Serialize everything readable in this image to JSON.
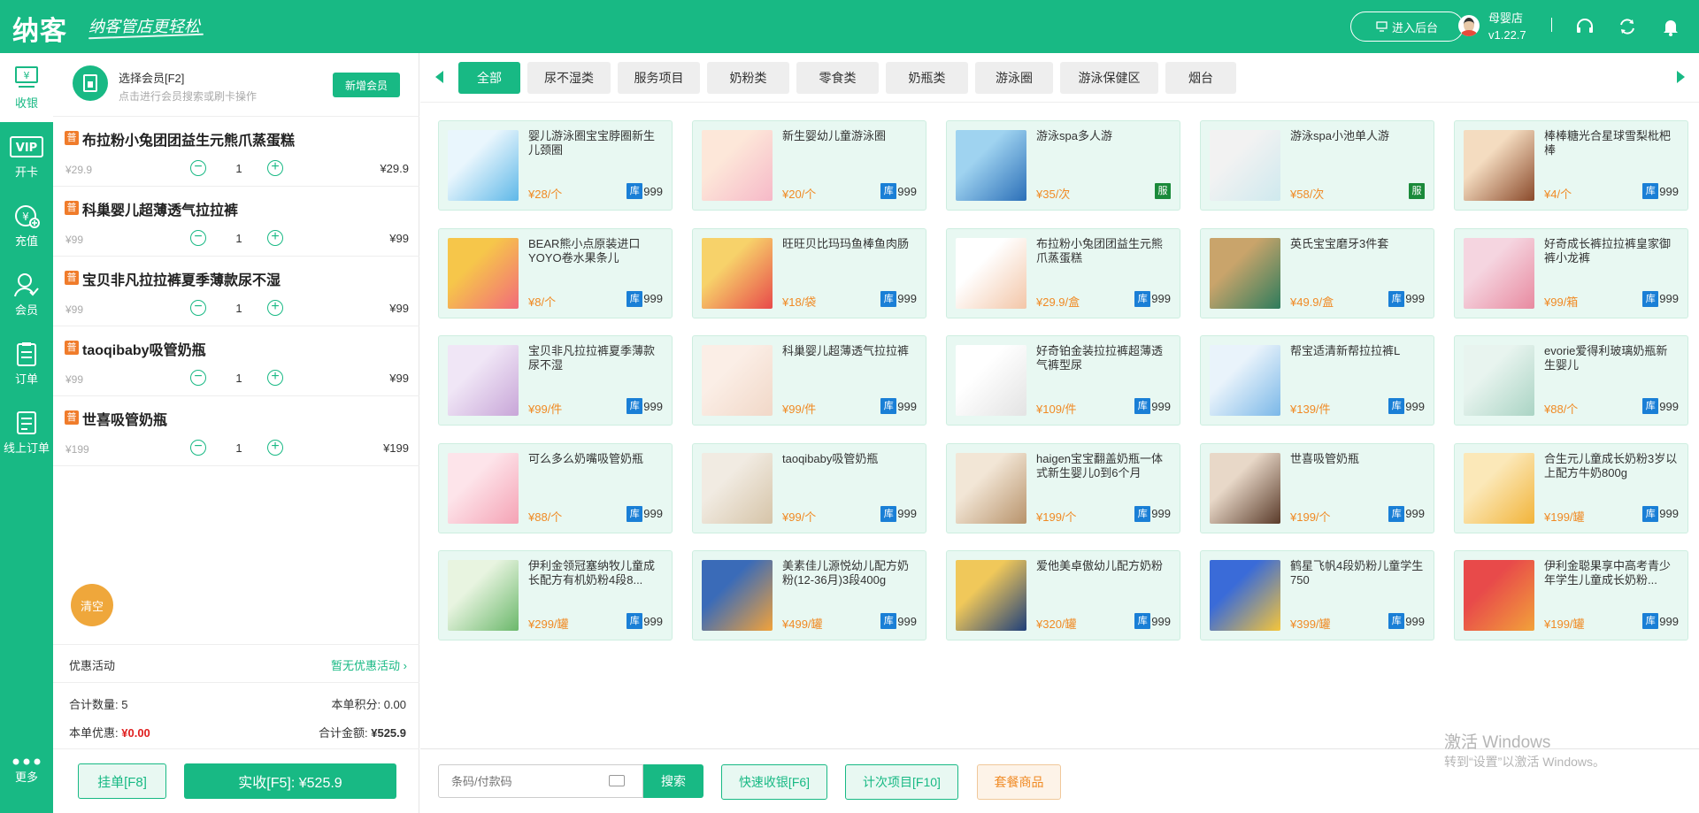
{
  "header": {
    "logo": "纳客",
    "slogan": "纳客管店更轻松",
    "backend_button": "进入后台",
    "store_name": "母婴店",
    "version": "v1.22.7"
  },
  "sidebar": {
    "items": [
      {
        "label": "收银",
        "icon": "cashier-icon"
      },
      {
        "label": "开卡",
        "icon": "vip-card-icon"
      },
      {
        "label": "充值",
        "icon": "recharge-icon"
      },
      {
        "label": "会员",
        "icon": "member-icon"
      },
      {
        "label": "订单",
        "icon": "order-icon"
      },
      {
        "label": "线上订单",
        "icon": "online-order-icon"
      }
    ],
    "more": "更多"
  },
  "member": {
    "title": "选择会员[F2]",
    "subtitle": "点击进行会员搜索或刷卡操作",
    "add_button": "新增会员"
  },
  "cart": {
    "badge": "普",
    "items": [
      {
        "name": "布拉粉小兔团团益生元熊爪蒸蛋糕",
        "price": "¥29.9",
        "qty": "1",
        "total": "¥29.9"
      },
      {
        "name": "科巢婴儿超薄透气拉拉裤",
        "price": "¥99",
        "qty": "1",
        "total": "¥99"
      },
      {
        "name": "宝贝非凡拉拉裤夏季薄款尿不湿",
        "price": "¥99",
        "qty": "1",
        "total": "¥99"
      },
      {
        "name": "taoqibaby吸管奶瓶",
        "price": "¥99",
        "qty": "1",
        "total": "¥99"
      },
      {
        "name": "世喜吸管奶瓶",
        "price": "¥199",
        "qty": "1",
        "total": "¥199"
      }
    ],
    "clear": "清空",
    "promo_label": "优惠活动",
    "promo_value": "暂无优惠活动",
    "total_qty_label": "合计数量:",
    "total_qty": "5",
    "points_label": "本单积分:",
    "points": "0.00",
    "discount_label": "本单优惠:",
    "discount": "¥0.00",
    "amount_label": "合计金额:",
    "amount": "¥525.9",
    "hang_button": "挂单[F8]",
    "pay_button": "实收[F5]: ¥525.9"
  },
  "tabs": [
    "全部",
    "尿不湿类",
    "服务项目",
    "奶粉类",
    "零食类",
    "奶瓶类",
    "游泳圈",
    "游泳保健区",
    "烟台"
  ],
  "stock_tag": "库",
  "service_tag": "服",
  "products": [
    {
      "name": "婴儿游泳圈宝宝脖圈新生儿颈圈",
      "price": "¥28/个",
      "stock": "999",
      "svc": false
    },
    {
      "name": "新生婴幼儿童游泳圈",
      "price": "¥20/个",
      "stock": "999",
      "svc": false
    },
    {
      "name": "游泳spa多人游",
      "price": "¥35/次",
      "stock": "",
      "svc": true
    },
    {
      "name": "游泳spa小池单人游",
      "price": "¥58/次",
      "stock": "",
      "svc": true
    },
    {
      "name": "棒棒糖光合星球雪梨枇杷棒",
      "price": "¥4/个",
      "stock": "999",
      "svc": false
    },
    {
      "name": "BEAR熊小点原装进口YOYO卷水果条儿",
      "price": "¥8/个",
      "stock": "999",
      "svc": false
    },
    {
      "name": "旺旺贝比玛玛鱼棒鱼肉肠",
      "price": "¥18/袋",
      "stock": "999",
      "svc": false
    },
    {
      "name": "布拉粉小兔团团益生元熊爪蒸蛋糕",
      "price": "¥29.9/盒",
      "stock": "999",
      "svc": false
    },
    {
      "name": "英氏宝宝磨牙3件套",
      "price": "¥49.9/盒",
      "stock": "999",
      "svc": false
    },
    {
      "name": "好奇成长裤拉拉裤皇家御裤小龙裤",
      "price": "¥99/箱",
      "stock": "999",
      "svc": false
    },
    {
      "name": "宝贝非凡拉拉裤夏季薄款尿不湿",
      "price": "¥99/件",
      "stock": "999",
      "svc": false
    },
    {
      "name": "科巢婴儿超薄透气拉拉裤",
      "price": "¥99/件",
      "stock": "999",
      "svc": false
    },
    {
      "name": "好奇铂金装拉拉裤超薄透气裤型尿",
      "price": "¥109/件",
      "stock": "999",
      "svc": false
    },
    {
      "name": "帮宝适清新帮拉拉裤L",
      "price": "¥139/件",
      "stock": "999",
      "svc": false
    },
    {
      "name": "evorie爱得利玻璃奶瓶新生婴儿",
      "price": "¥88/个",
      "stock": "999",
      "svc": false
    },
    {
      "name": "可么多么奶嘴吸管奶瓶",
      "price": "¥88/个",
      "stock": "999",
      "svc": false
    },
    {
      "name": "taoqibaby吸管奶瓶",
      "price": "¥99/个",
      "stock": "999",
      "svc": false
    },
    {
      "name": "haigen宝宝翻盖奶瓶一体式新生婴儿0到6个月",
      "price": "¥199/个",
      "stock": "999",
      "svc": false
    },
    {
      "name": "世喜吸管奶瓶",
      "price": "¥199/个",
      "stock": "999",
      "svc": false
    },
    {
      "name": "合生元儿童成长奶粉3岁以上配方牛奶800g",
      "price": "¥199/罐",
      "stock": "999",
      "svc": false
    },
    {
      "name": "伊利金领冠塞纳牧儿童成长配方有机奶粉4段8...",
      "price": "¥299/罐",
      "stock": "999",
      "svc": false
    },
    {
      "name": "美素佳儿源悦幼儿配方奶粉(12-36月)3段400g",
      "price": "¥499/罐",
      "stock": "999",
      "svc": false
    },
    {
      "name": "爱他美卓傲幼儿配方奶粉",
      "price": "¥320/罐",
      "stock": "999",
      "svc": false
    },
    {
      "name": "鹤星飞帆4段奶粉儿童学生750",
      "price": "¥399/罐",
      "stock": "999",
      "svc": false
    },
    {
      "name": "伊利金聪果享中高考青少年学生儿童成长奶粉...",
      "price": "¥199/罐",
      "stock": "999",
      "svc": false
    }
  ],
  "bottom": {
    "scan_placeholder": "条码/付款码",
    "search_button": "搜索",
    "quick_cash": "快速收银[F6]",
    "count_item": "计次项目[F10]",
    "package": "套餐商品"
  },
  "watermark": {
    "line1": "激活 Windows",
    "line2": "转到“设置”以激活 Windows。"
  },
  "colors": {
    "brand": "#18b984",
    "price": "#f08a24",
    "stock_tag": "#1a7fd6",
    "service_tag": "#1a8a3a",
    "clear_button": "#efa73b"
  }
}
